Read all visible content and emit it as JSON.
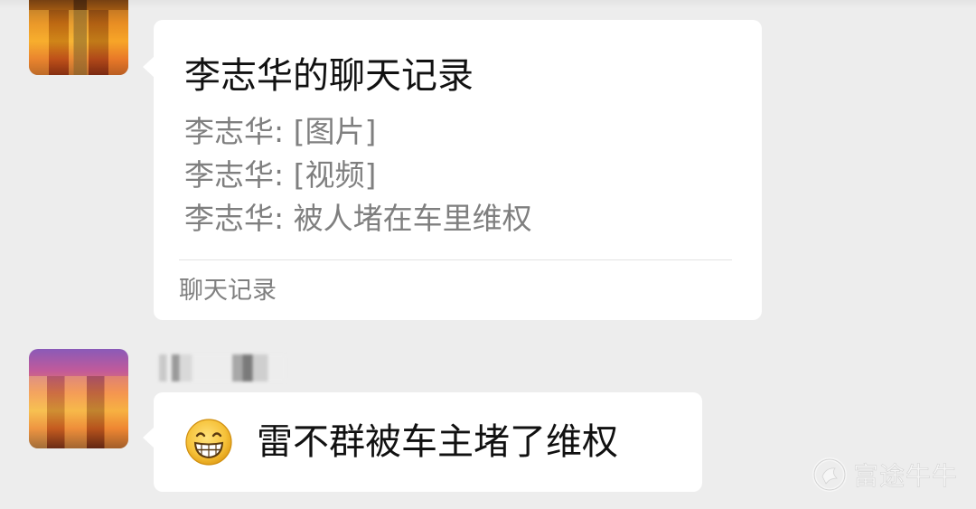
{
  "chat": {
    "messages": [
      {
        "type": "forwarded-chat-record",
        "title": "李志华的聊天记录",
        "lines": [
          "李志华: [图片]",
          "李志华: [视频]",
          "李志华: 被人堵在车里维权"
        ],
        "footer": "聊天记录"
      },
      {
        "type": "text",
        "sender_name": "",
        "emoji": "grinning-face-emoji",
        "text": "雷不群被车主堵了维权"
      }
    ]
  },
  "watermark": {
    "icon": "futu-logo-icon",
    "text": "富途牛牛"
  },
  "colors": {
    "background": "#ededed",
    "bubble": "#ffffff",
    "primary_text": "#111111",
    "secondary_text": "#7f7f7f"
  }
}
